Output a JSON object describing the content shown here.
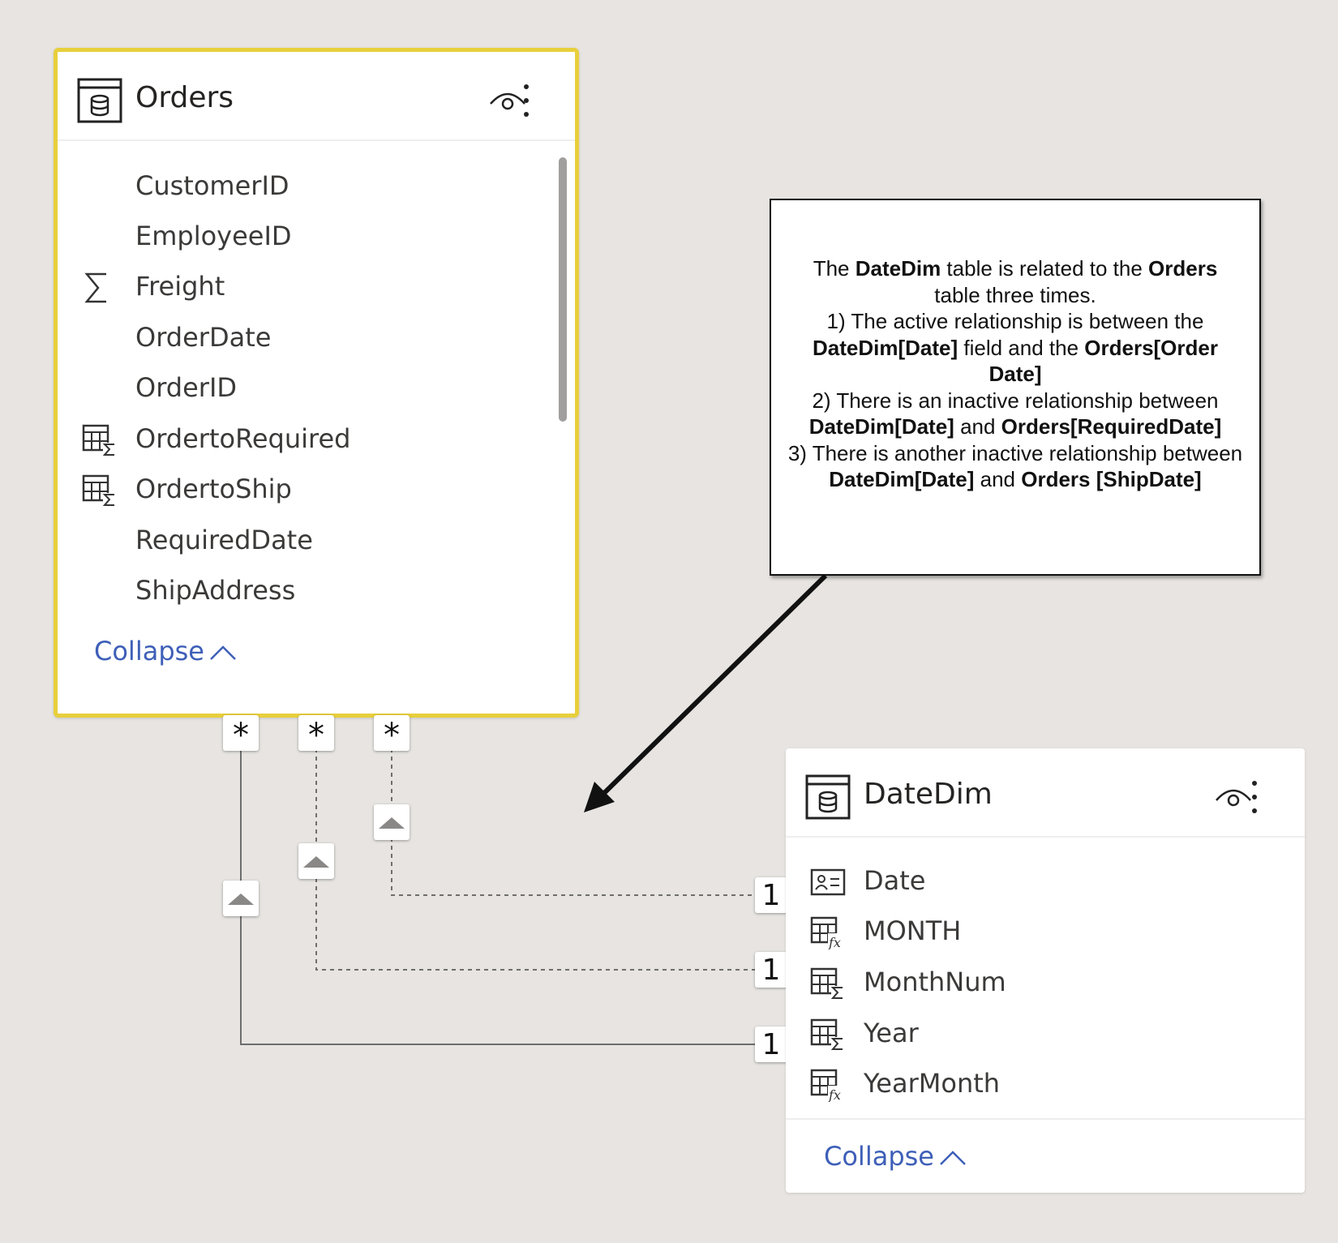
{
  "orders_table": {
    "title": "Orders",
    "icon": "table-icon",
    "fields": [
      {
        "name": "CustomerID",
        "icon": ""
      },
      {
        "name": "EmployeeID",
        "icon": ""
      },
      {
        "name": "Freight",
        "icon": "sigma-icon"
      },
      {
        "name": "OrderDate",
        "icon": ""
      },
      {
        "name": "OrderID",
        "icon": ""
      },
      {
        "name": "OrdertoRequired",
        "icon": "calculated-column-sum-icon"
      },
      {
        "name": "OrdertoShip",
        "icon": "calculated-column-sum-icon"
      },
      {
        "name": "RequiredDate",
        "icon": ""
      },
      {
        "name": "ShipAddress",
        "icon": ""
      }
    ],
    "collapse_label": "Collapse",
    "border_color": "#e8cf3c"
  },
  "datedim_table": {
    "title": "DateDim",
    "icon": "table-icon",
    "fields": [
      {
        "name": "Date",
        "icon": "key-column-icon"
      },
      {
        "name": "MONTH",
        "icon": "calculated-column-fx-icon"
      },
      {
        "name": "MonthNum",
        "icon": "calculated-column-sum-icon"
      },
      {
        "name": "Year",
        "icon": "calculated-column-sum-icon"
      },
      {
        "name": "YearMonth",
        "icon": "calculated-column-fx-icon"
      }
    ],
    "collapse_label": "Collapse"
  },
  "relationships": [
    {
      "from": "Orders",
      "to": "DateDim",
      "from_cardinality": "*",
      "to_cardinality": "1",
      "active": true
    },
    {
      "from": "Orders",
      "to": "DateDim",
      "from_cardinality": "*",
      "to_cardinality": "1",
      "active": false
    },
    {
      "from": "Orders",
      "to": "DateDim",
      "from_cardinality": "*",
      "to_cardinality": "1",
      "active": false
    }
  ],
  "annotation": {
    "p1": "The ",
    "p1b": "DateDim",
    "p2": " table is related to the ",
    "p2b": "Orders",
    "p3": " table three times.",
    "l1a": "1) The active relationship is between the ",
    "l1b": "DateDim[Date]",
    "l1c": " field and the ",
    "l1d": "Orders[Order Date]",
    "l2a": "2) There is an inactive relationship between ",
    "l2b": "DateDim[Date]",
    "l2c": " and ",
    "l2d": "Orders[RequiredDate]",
    "l3a": "3) There is another inactive relationship between ",
    "l3b": "DateDim[Date]",
    "l3c": " and ",
    "l3d": "Orders [ShipDate]"
  },
  "colors": {
    "link": "#3e5fb8",
    "canvas": "#e7e4e1"
  }
}
